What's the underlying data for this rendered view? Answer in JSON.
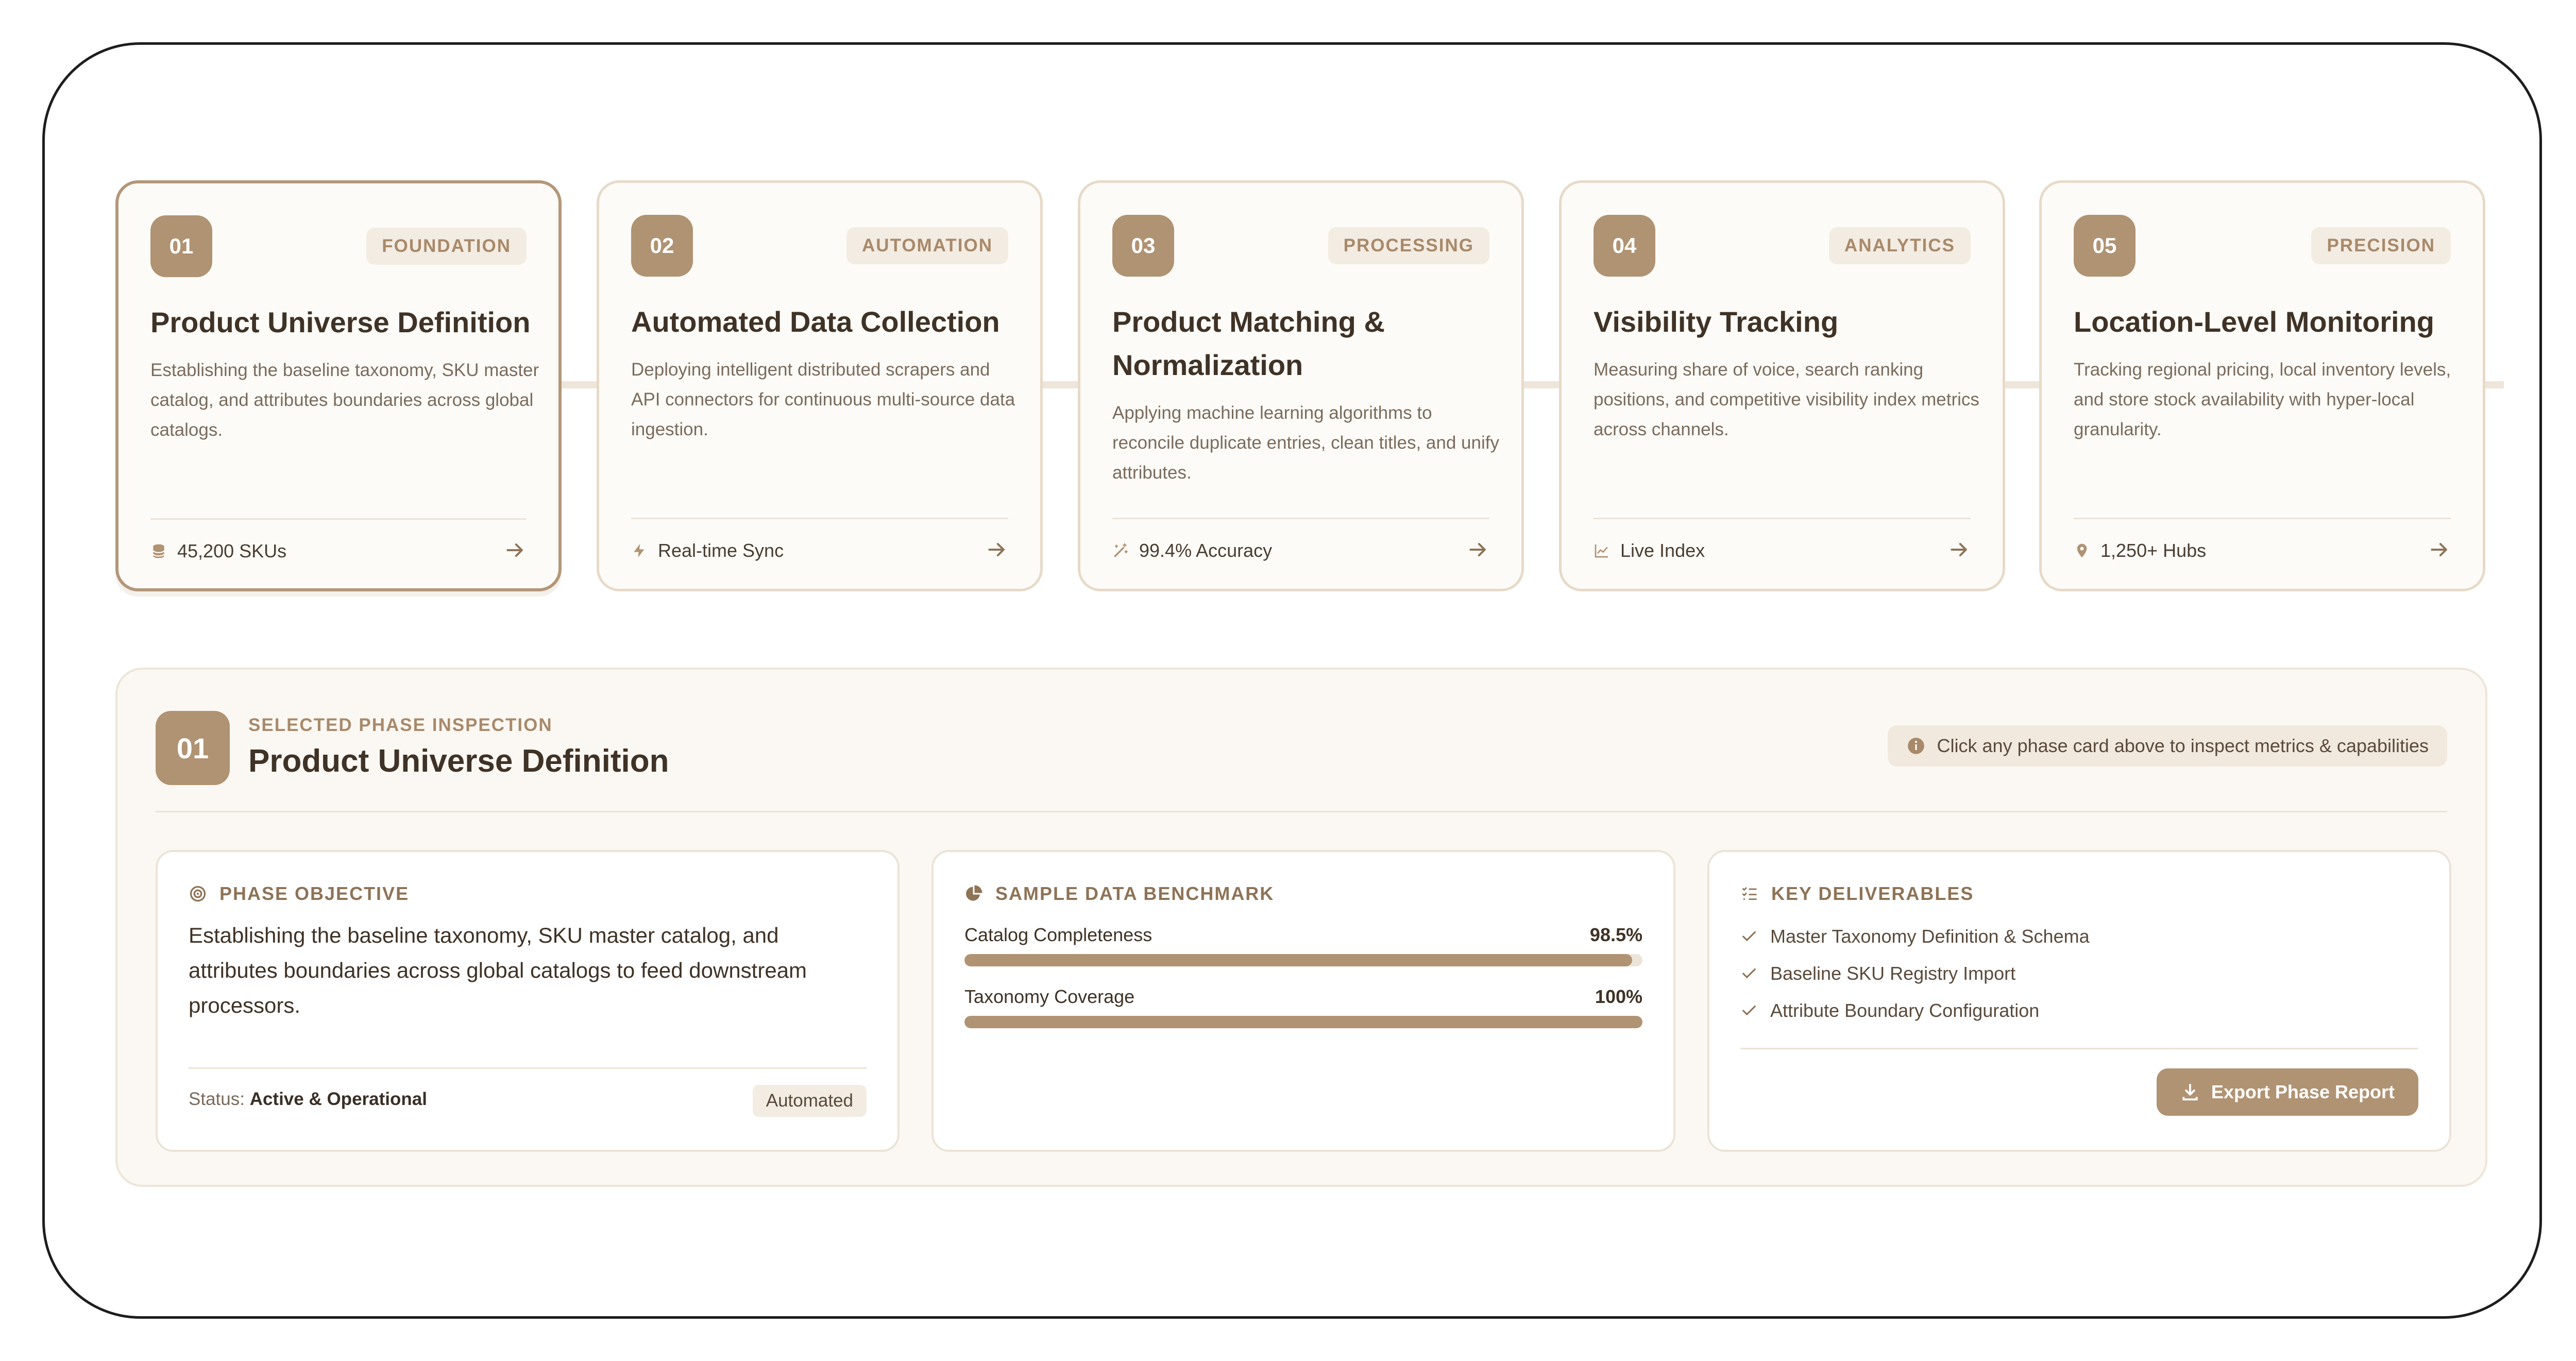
{
  "phases": [
    {
      "number": "01",
      "tag": "FOUNDATION",
      "title": "Product Universe Definition",
      "description": "Establishing the baseline taxonomy, SKU master catalog, and attributes boundaries across global catalogs.",
      "metric": "45,200 SKUs",
      "metric_icon": "database-icon"
    },
    {
      "number": "02",
      "tag": "AUTOMATION",
      "title": "Automated Data Collection",
      "description": "Deploying intelligent distributed scrapers and API connectors for continuous multi-source data ingestion.",
      "metric": "Real-time Sync",
      "metric_icon": "lightning-icon"
    },
    {
      "number": "03",
      "tag": "PROCESSING",
      "title": "Product Matching & Normalization",
      "description": "Applying machine learning algorithms to reconcile duplicate entries, clean titles, and unify attributes.",
      "metric": "99.4% Accuracy",
      "metric_icon": "magic-wand-icon"
    },
    {
      "number": "04",
      "tag": "ANALYTICS",
      "title": "Visibility Tracking",
      "description": "Measuring share of voice, search ranking positions, and competitive visibility index metrics across channels.",
      "metric": "Live Index",
      "metric_icon": "line-chart-icon"
    },
    {
      "number": "05",
      "tag": "PRECISION",
      "title": "Location-Level Monitoring",
      "description": "Tracking regional pricing, local inventory levels, and store stock availability with hyper-local granularity.",
      "metric": "1,250+ Hubs",
      "metric_icon": "map-pin-icon"
    }
  ],
  "inspection": {
    "number": "01",
    "label": "SELECTED PHASE INSPECTION",
    "title": "Product Universe Definition",
    "hint": "Click any phase card above to inspect metrics & capabilities",
    "objective": {
      "heading": "PHASE OBJECTIVE",
      "text": "Establishing the baseline taxonomy, SKU master catalog, and attributes boundaries across global catalogs to feed downstream processors.",
      "status_label": "Status:",
      "status_value": "Active & Operational",
      "badge": "Automated"
    },
    "benchmark": {
      "heading": "SAMPLE DATA BENCHMARK",
      "items": [
        {
          "label": "Catalog Completeness",
          "value": "98.5%",
          "fraction": 0.985
        },
        {
          "label": "Taxonomy Coverage",
          "value": "100%",
          "fraction": 1.0
        }
      ]
    },
    "deliverables": {
      "heading": "KEY DELIVERABLES",
      "items": [
        "Master Taxonomy Definition & Schema",
        "Baseline SKU Registry Import",
        "Attribute Boundary Configuration"
      ],
      "export_label": "Export Phase Report"
    }
  },
  "colors": {
    "accent": "#b09373",
    "tag_text": "#a8896a",
    "card_bg": "#fdfbf7",
    "border": "#e7dac9"
  }
}
